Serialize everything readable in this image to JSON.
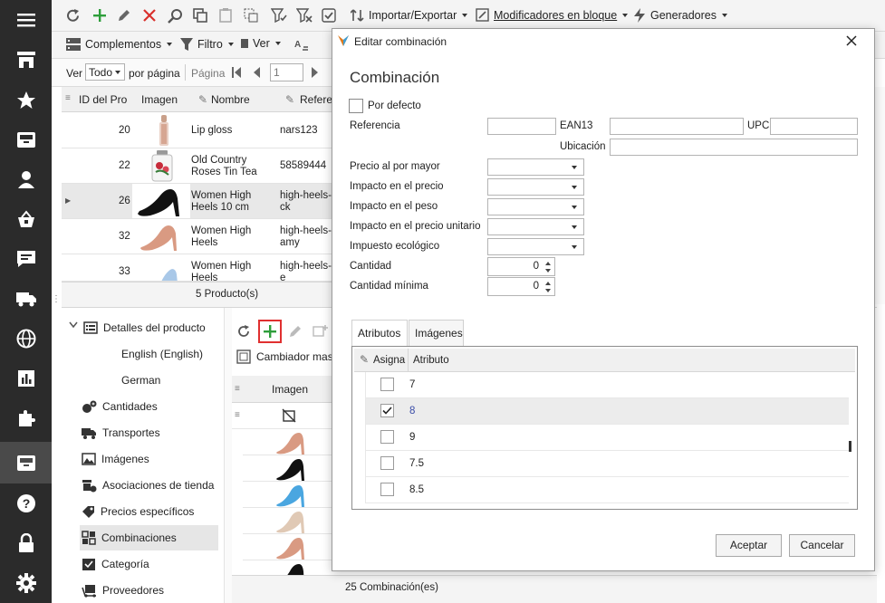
{
  "sidebar": {
    "items": [
      "menu-icon",
      "store-icon",
      "star-icon",
      "inbox-icon",
      "user-icon",
      "basket-icon",
      "chat-icon",
      "truck-icon",
      "globe-icon",
      "chart-icon",
      "puzzle-icon",
      "box-icon",
      "help-icon",
      "lock-icon",
      "gear-icon"
    ],
    "active": "box-icon"
  },
  "toolbar1": {
    "import_export": "Importar/Exportar",
    "bulk_modifiers": "Modificadores en bloque",
    "generators": "Generadores"
  },
  "toolbar2": {
    "addons": "Complementos",
    "filter": "Filtro",
    "view": "Ver"
  },
  "pager": {
    "show_label": "Ver",
    "show_value": "Todo",
    "per_page": "por página",
    "page_label": "Página",
    "page_value": "1"
  },
  "products": {
    "columns": [
      "ID del Pro",
      "Imagen",
      "Nombre",
      "Referen"
    ],
    "rows": [
      {
        "id": "20",
        "name": "Lip gloss",
        "ref": "nars123"
      },
      {
        "id": "22",
        "name": "Old Country Roses Tin Tea",
        "ref": "58589444"
      },
      {
        "id": "26",
        "name": "Women High Heels 10 cm",
        "ref": "high-heels-ck"
      },
      {
        "id": "32",
        "name": "Women High Heels",
        "ref": "high-heels-amy"
      },
      {
        "id": "33",
        "name": "Women High Heels",
        "ref": "high-heels-e"
      }
    ],
    "count": "5 Producto(s)"
  },
  "details_tree": {
    "items": [
      {
        "label": "Detalles del producto",
        "icon": "details-icon"
      },
      {
        "label": "English (English)",
        "icon": ""
      },
      {
        "label": "German",
        "icon": ""
      },
      {
        "label": "Cantidades",
        "icon": "quantities-icon"
      },
      {
        "label": "Transportes",
        "icon": "truck-icon"
      },
      {
        "label": "Imágenes",
        "icon": "images-icon"
      },
      {
        "label": "Asociaciones de tienda",
        "icon": "store-assoc-icon"
      },
      {
        "label": "Precios específicos",
        "icon": "tag-icon"
      },
      {
        "label": "Combinaciones",
        "icon": "combinations-icon"
      },
      {
        "label": "Categoría",
        "icon": "category-icon"
      },
      {
        "label": "Proveedores",
        "icon": "suppliers-icon"
      }
    ],
    "selected": "Combinaciones"
  },
  "combos": {
    "mass_changer": "Cambiador mas",
    "image_col": "Imagen",
    "count": "25 Combinación(es)",
    "shoe_colors": [
      "none",
      "#d99a82",
      "#111111",
      "#4aa6e0",
      "#e0c9b5",
      "#d99a82",
      "#111111"
    ]
  },
  "dialog": {
    "window_title": "Editar combinación",
    "heading": "Combinación",
    "default_label": "Por defecto",
    "reference_label": "Referencia",
    "ean13_label": "EAN13",
    "upc_label": "UPC",
    "location_label": "Ubicación",
    "wholesale_label": "Precio al por mayor",
    "price_impact_label": "Impacto en el precio",
    "weight_impact_label": "Impacto en el peso",
    "unit_price_impact_label": "Impacto en el precio unitario",
    "ecotax_label": "Impuesto ecológico",
    "quantity_label": "Cantidad",
    "quantity_value": "0",
    "min_quantity_label": "Cantidad mínima",
    "min_quantity_value": "0",
    "tabs": [
      "Atributos",
      "Imágenes"
    ],
    "attr_col_assign": "Asigna",
    "attr_col_attribute": "Atributo",
    "attributes": [
      {
        "value": "7",
        "checked": false
      },
      {
        "value": "8",
        "checked": true
      },
      {
        "value": "9",
        "checked": false
      },
      {
        "value": "7.5",
        "checked": false
      },
      {
        "value": "8.5",
        "checked": false
      }
    ],
    "ok_label": "Aceptar",
    "cancel_label": "Cancelar"
  }
}
